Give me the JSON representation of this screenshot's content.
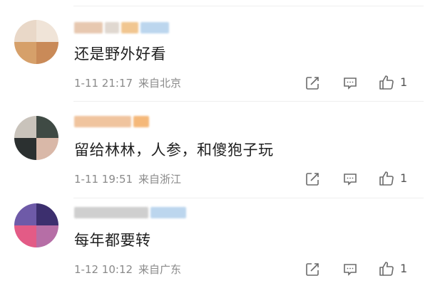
{
  "comments": [
    {
      "avatar": {
        "colors": [
          "#e9d8c8",
          "#d6a06a",
          "#f0e4d8",
          "#c98a58"
        ]
      },
      "username_blocks": [
        {
          "w": 40,
          "color": "#e7c8b0"
        },
        {
          "w": 20,
          "color": "#e0d8d0"
        },
        {
          "w": 24,
          "color": "#f1c690"
        },
        {
          "w": 40,
          "color": "#bcd6ee"
        }
      ],
      "content": "还是野外好看",
      "time": "1-11 21:17",
      "location": "来自北京",
      "likes": "1"
    },
    {
      "avatar": {
        "colors": [
          "#3f4a44",
          "#c9c3bb",
          "#2b3030",
          "#d9b8a8"
        ]
      },
      "username_blocks": [
        {
          "w": 80,
          "color": "#f0c49e"
        },
        {
          "w": 22,
          "color": "#f5b879"
        }
      ],
      "content": "留给林林，人参，和傻狍子玩",
      "time": "1-11 19:51",
      "location": "来自浙江",
      "likes": "1"
    },
    {
      "avatar": {
        "colors": [
          "#6e5aa8",
          "#e35b86",
          "#3c2f6e",
          "#b66ea6"
        ]
      },
      "username_blocks": [
        {
          "w": 104,
          "color": "#cfcfcf"
        },
        {
          "w": 50,
          "color": "#bcd6ee"
        }
      ],
      "content": "每年都要转",
      "time": "1-12 10:12",
      "location": "来自广东",
      "likes": "1"
    }
  ],
  "icons": {
    "share": "share-icon",
    "comment": "comment-icon",
    "like": "like-icon"
  },
  "colors": {
    "text_primary": "#1f1f1f",
    "text_meta": "#8a8a8a",
    "icon": "#6b6b6b",
    "divider": "#efefef"
  }
}
